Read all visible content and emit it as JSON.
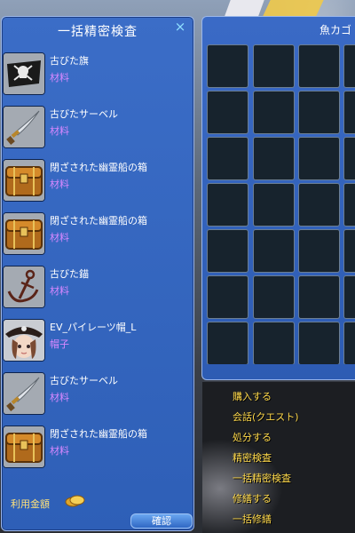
{
  "panel": {
    "title": "一括精密検査",
    "close_glyph": "×",
    "items": [
      {
        "name": "古びた旗",
        "category": "材料",
        "icon": "pirate-flag-icon"
      },
      {
        "name": "古びたサーベル",
        "category": "材料",
        "icon": "saber-icon"
      },
      {
        "name": "閉ざされた幽霊船の箱",
        "category": "材料",
        "icon": "treasure-chest-icon"
      },
      {
        "name": "閉ざされた幽霊船の箱",
        "category": "材料",
        "icon": "treasure-chest-icon"
      },
      {
        "name": "古びた錨",
        "category": "材料",
        "icon": "anchor-icon"
      },
      {
        "name": "EV_パイレーツ帽_L",
        "category": "帽子",
        "icon": "pirate-hat-avatar-icon"
      },
      {
        "name": "古びたサーベル",
        "category": "材料",
        "icon": "saber-icon"
      },
      {
        "name": "閉ざされた幽霊船の箱",
        "category": "材料",
        "icon": "treasure-chest-icon"
      }
    ],
    "cost_label": "利用金額",
    "confirm_label": "確認"
  },
  "inventory": {
    "title": "魚カゴ"
  },
  "menu": {
    "items": [
      "購入する",
      "会話(クエスト)",
      "処分する",
      "精密検査",
      "一括精密検査",
      "修繕する",
      "一括修繕"
    ]
  },
  "colors": {
    "panel_blue": "#2e5fb7",
    "category_purple": "#d888ff",
    "menu_yellow": "#ffd94a"
  }
}
